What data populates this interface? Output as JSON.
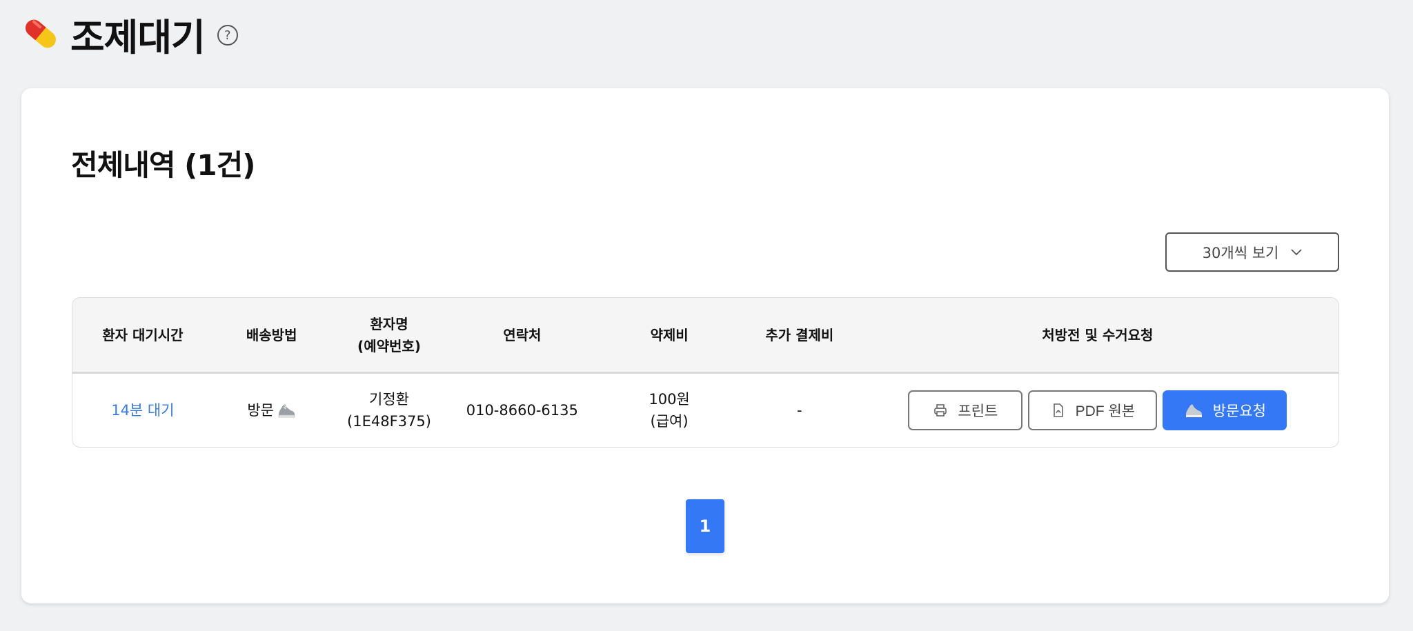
{
  "header": {
    "title": "조제대기",
    "icon": "pill-icon",
    "help": "?"
  },
  "section": {
    "title": "전체내역 (1건)"
  },
  "page_size": {
    "selected": "30개씩 보기"
  },
  "table": {
    "columns": [
      "환자 대기시간",
      "배송방법",
      "환자명",
      "(예약번호)",
      "연락처",
      "약제비",
      "추가 결제비",
      "처방전 및 수거요청"
    ],
    "rows": [
      {
        "wait_time": "14분 대기",
        "delivery": "방문",
        "patient_name": "기정환",
        "reservation_no": "(1E48F375)",
        "contact": "010-8660-6135",
        "drug_fee": "100원",
        "drug_fee_type": "(급여)",
        "extra_fee": "-",
        "actions": {
          "print": "프린트",
          "pdf": "PDF 원본",
          "visit": "방문요청"
        }
      }
    ]
  },
  "pagination": {
    "current": "1"
  },
  "colors": {
    "accent": "#3478f6",
    "link": "#3a7bd5",
    "background": "#f0f1f3"
  }
}
